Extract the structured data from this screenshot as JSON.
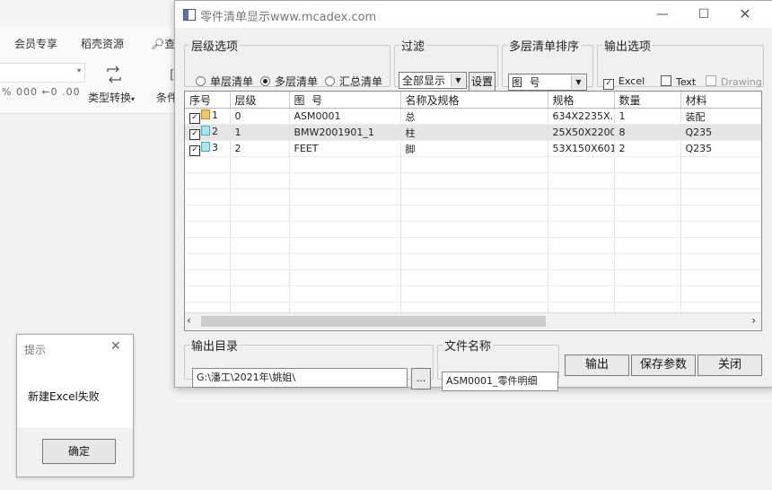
{
  "background_app": {
    "tabs": [
      "会员专享",
      "稻壳资源",
      "查"
    ],
    "type_convert_label": "类型转换",
    "conditional_label": "条件",
    "number_format_glyphs": "% 000 ←0 .00",
    "search_icon": "search-icon"
  },
  "dialog": {
    "title": "零件清单显示www.mcadex.com",
    "level_group": {
      "legend": "层级选项",
      "options": [
        "单层清单",
        "多层清单",
        "汇总清单"
      ],
      "selected": "多层清单"
    },
    "filter_group": {
      "legend": "过滤",
      "value": "全部显示",
      "set_label": "设置"
    },
    "sort_group": {
      "legend": "多层清单排序",
      "value": "图  号"
    },
    "output_group": {
      "legend": "输出选项",
      "options": [
        {
          "label": "Excel",
          "checked": true,
          "enabled": true
        },
        {
          "label": "Text",
          "checked": false,
          "enabled": true
        },
        {
          "label": "Drawing",
          "checked": false,
          "enabled": false
        }
      ]
    },
    "table": {
      "headers": [
        "序号",
        "层级",
        "图  号",
        "名称及规格",
        "规格",
        "数量",
        "材料"
      ],
      "rows": [
        {
          "seq": "1",
          "level": "0",
          "drawing_no": "ASM0001",
          "name": "总",
          "spec": "634X2235X...",
          "qty": "1",
          "material": "装配",
          "checked": true,
          "icon": "assembly-icon"
        },
        {
          "seq": "2",
          "level": "1",
          "drawing_no": "BMW2001901_1",
          "name": "柱",
          "spec": "25X50X2200",
          "qty": "8",
          "material": "Q235",
          "checked": true,
          "icon": "part-icon"
        },
        {
          "seq": "3",
          "level": "2",
          "drawing_no": "FEET",
          "name": "脚",
          "spec": "53X150X601",
          "qty": "2",
          "material": "Q235",
          "checked": true,
          "icon": "part-icon"
        }
      ],
      "selected_row": 1
    },
    "output_dir": {
      "legend": "输出目录",
      "value": "G:\\潘工\\2021年\\姚姐\\",
      "browse_label": "..."
    },
    "file_name": {
      "legend": "文件名称",
      "value": "ASM0001_零件明细"
    },
    "buttons": {
      "output": "输出",
      "save_params": "保存参数",
      "close": "关闭"
    }
  },
  "message_box": {
    "title": "提示",
    "text": "新建Excel失败",
    "ok_label": "确定"
  },
  "colors": {
    "dialog_bg": "#f0f0f0",
    "selected_row": "#e5e5e5"
  }
}
